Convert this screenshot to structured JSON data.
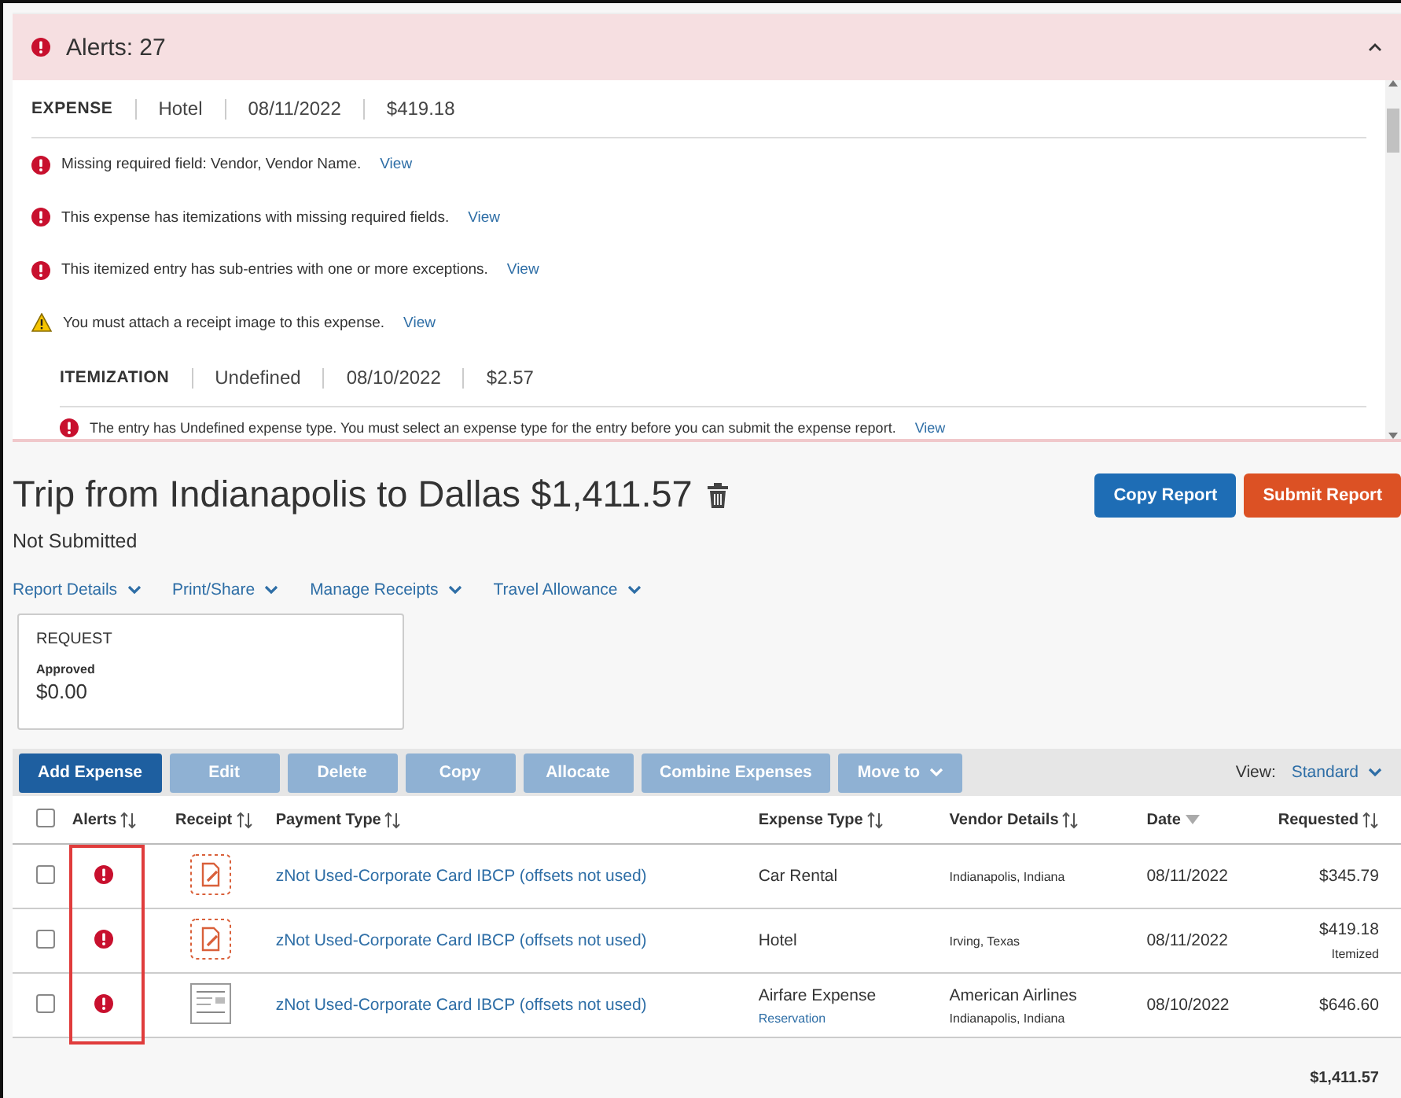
{
  "alerts": {
    "title": "Alerts: 27",
    "expanded": true,
    "groups": [
      {
        "kind": "expense",
        "label": "EXPENSE",
        "fields": [
          "Hotel",
          "08/11/2022",
          "$419.18"
        ],
        "messages": [
          {
            "kind": "error",
            "text": "Missing required field: Vendor, Vendor Name.",
            "link": "View"
          },
          {
            "kind": "error",
            "text": "This expense has itemizations with missing required fields.",
            "link": "View"
          },
          {
            "kind": "error",
            "text": "This itemized entry has sub-entries with one or more exceptions.",
            "link": "View"
          },
          {
            "kind": "warning",
            "text": "You must attach a receipt image to this expense.",
            "link": "View"
          }
        ]
      },
      {
        "kind": "itemization",
        "label": "ITEMIZATION",
        "fields": [
          "Undefined",
          "08/10/2022",
          "$2.57"
        ],
        "messages": [
          {
            "kind": "error",
            "text": "The entry has Undefined expense type. You must select an expense type for the entry before you can submit the expense report.",
            "link": "View"
          }
        ]
      }
    ]
  },
  "report": {
    "title": "Trip from Indianapolis to Dallas $1,411.57",
    "status": "Not Submitted",
    "actions": [
      {
        "label": "Copy Report",
        "kind": "primary"
      },
      {
        "label": "Submit Report",
        "kind": "danger"
      }
    ],
    "menus": [
      "Report Details",
      "Print/Share",
      "Manage Receipts",
      "Travel Allowance"
    ],
    "request": {
      "heading": "REQUEST",
      "status": "Approved",
      "amount": "$0.00"
    }
  },
  "toolbar": {
    "buttons": [
      {
        "label": "Add Expense",
        "disabled": false,
        "dropdown": false
      },
      {
        "label": "Edit",
        "disabled": true,
        "dropdown": false
      },
      {
        "label": "Delete",
        "disabled": true,
        "dropdown": false
      },
      {
        "label": "Copy",
        "disabled": true,
        "dropdown": false
      },
      {
        "label": "Allocate",
        "disabled": true,
        "dropdown": false
      },
      {
        "label": "Combine Expenses",
        "disabled": true,
        "dropdown": false
      },
      {
        "label": "Move to",
        "disabled": true,
        "dropdown": true
      }
    ],
    "view_label": "View:",
    "view_value": "Standard"
  },
  "table": {
    "select_all": false,
    "columns": [
      {
        "label": "Alerts",
        "sorted": false
      },
      {
        "label": "Receipt",
        "sorted": false
      },
      {
        "label": "Payment Type",
        "sorted": false
      },
      {
        "label": "Expense Type",
        "sorted": false
      },
      {
        "label": "Vendor Details",
        "sorted": false
      },
      {
        "label": "Date",
        "sorted": true
      },
      {
        "label": "Requested",
        "sorted": false
      }
    ],
    "alerts_column_highlighted": true,
    "rows": [
      {
        "checked": false,
        "alert": true,
        "receipt_attached": false,
        "payment_type": "zNot Used-Corporate Card IBCP (offsets not used)",
        "expense_type": "Car Rental",
        "vendor_location": "Indianapolis, Indiana",
        "date": "08/11/2022",
        "amount": "$345.79"
      },
      {
        "checked": false,
        "alert": true,
        "receipt_attached": false,
        "payment_type": "zNot Used-Corporate Card IBCP (offsets not used)",
        "expense_type": "Hotel",
        "vendor_location": "Irving, Texas",
        "date": "08/11/2022",
        "amount": "$419.18",
        "amount_note": "Itemized"
      },
      {
        "checked": false,
        "alert": true,
        "receipt_attached": true,
        "payment_type": "zNot Used-Corporate Card IBCP (offsets not used)",
        "expense_type": "Airfare Expense",
        "expense_subtype": "Reservation",
        "vendor_name": "American Airlines",
        "vendor_location": "Indianapolis, Indiana",
        "date": "08/10/2022",
        "amount": "$646.60"
      }
    ],
    "total": "$1,411.57"
  }
}
